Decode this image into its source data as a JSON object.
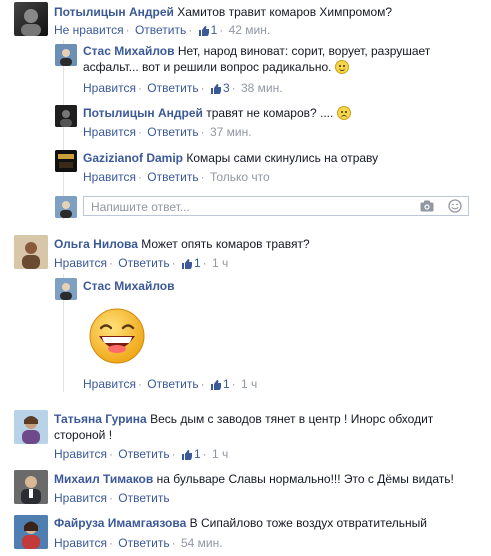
{
  "actions": {
    "like": "Нравится",
    "unlike": "Не нравится",
    "reply": "Ответить",
    "sep": "·"
  },
  "comments": [
    {
      "name": "Потылицын Андрей",
      "text": "Хамитов травит комаров Химпромом?",
      "like_label": "Не нравится",
      "likes": "1",
      "time": "42 мин."
    },
    {
      "name": "Стас Михайлов",
      "text": "Нет, народ виноват: сорит, ворует, разрушает асфальт... вот и решили вопрос радикально.",
      "like_label": "Нравится",
      "likes": "3",
      "time": "38 мин."
    },
    {
      "name": "Потылицын Андрей",
      "text": "травят не комаров? ....",
      "like_label": "Нравится",
      "time": "37 мин."
    },
    {
      "name": "Gazizianof Damip",
      "text": "Комары сами скинулись на отраву",
      "like_label": "Нравится",
      "time": "Только что"
    },
    {
      "name": "Ольга Нилова",
      "text": "Может опять комаров травят?",
      "like_label": "Нравится",
      "likes": "1",
      "time": "1 ч"
    },
    {
      "name": "Стас Михайлов",
      "text": "",
      "like_label": "Нравится",
      "likes": "1",
      "time": "1 ч"
    },
    {
      "name": "Татьяна Гурина",
      "text_line1": "Весь дым с заводов тянет в центр ! Инорс обходит",
      "text_line2": "стороной !",
      "like_label": "Нравится",
      "likes": "1",
      "time": "1 ч"
    },
    {
      "name": "Михаил Тимаков",
      "text": "на бульваре Славы нормально!!! Это с Дёмы видать!",
      "like_label": "Нравится"
    },
    {
      "name": "Файруза Имамгаязова",
      "text": "В Сипайлово тоже воздух отвратительный",
      "like_label": "Нравится",
      "time": "54 мин."
    }
  ],
  "reply_box": {
    "placeholder": "Напишите ответ..."
  },
  "colors": {
    "link": "#3b5998",
    "meta": "#9197a3",
    "border": "#bdc7d8"
  }
}
